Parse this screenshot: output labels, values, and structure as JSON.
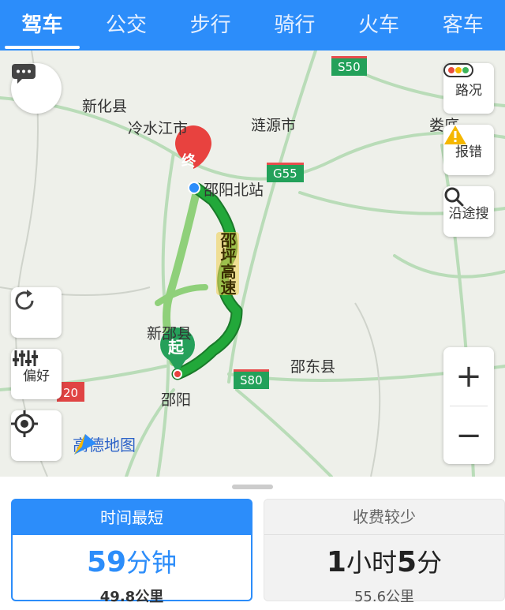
{
  "tabs": [
    {
      "label": "驾车",
      "active": true
    },
    {
      "label": "公交"
    },
    {
      "label": "步行"
    },
    {
      "label": "骑行"
    },
    {
      "label": "火车"
    },
    {
      "label": "客车"
    }
  ],
  "map": {
    "labels": {
      "xinhua": "新化县",
      "lengshuijiang": "冷水江市",
      "lianyuan": "涟源市",
      "loudi": "娄底",
      "shaoyangbeizhan": "邵阳北站",
      "xinshao": "新邵县",
      "shaodong": "邵东县",
      "shaoyang": "邵阳",
      "highway": "邵坪高速"
    },
    "road_badges": {
      "s50": "S50",
      "g55": "G55",
      "s80": "S80",
      "s20": "20"
    },
    "start_marker": "起",
    "end_marker": "终",
    "route_color": "#22a83a",
    "accent_color": "#2c8dfa"
  },
  "buttons": {
    "traffic": "路况",
    "report": "报错",
    "search_along": "沿途搜",
    "preference": "偏好",
    "zoom_in": "+",
    "zoom_out": "−"
  },
  "brand": "高德地图",
  "routes": [
    {
      "header": "时间最短",
      "time_num": "59",
      "time_unit": "分钟",
      "distance": "49.8公里",
      "selected": true
    },
    {
      "header": "收费较少",
      "time_h": "1",
      "time_h_unit": "小时",
      "time_m": "5",
      "time_m_unit": "分",
      "distance": "55.6公里",
      "selected": false
    }
  ]
}
